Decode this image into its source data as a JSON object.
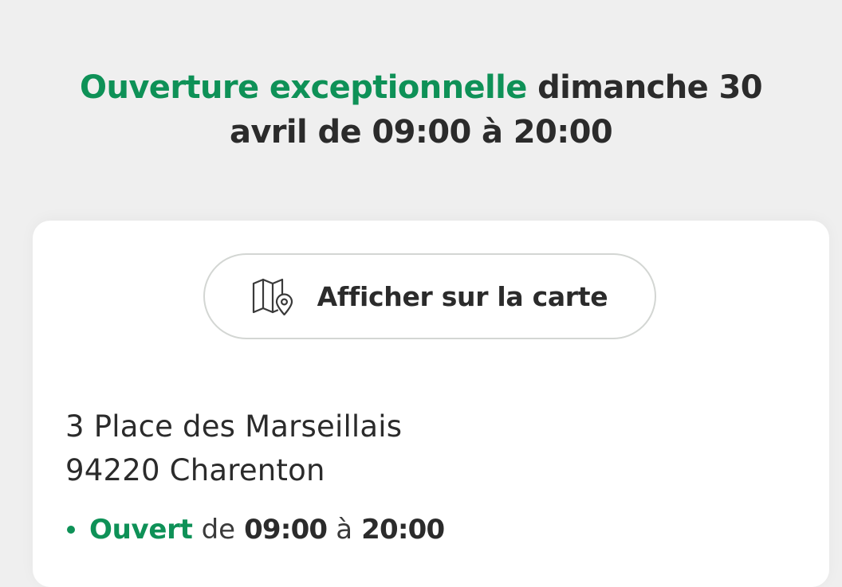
{
  "banner": {
    "highlight": "Ouverture exceptionnelle",
    "rest_line1": "dimanche 30",
    "rest_line2": "avril de 09:00 à 20:00"
  },
  "map_button": {
    "label": "Afficher sur la carte",
    "icon": "map-pin-icon"
  },
  "address": {
    "line1": "3 Place des Marseillais",
    "line2": "94220 Charenton"
  },
  "status": {
    "state": "Ouvert",
    "from_word": "de",
    "open_time": "09:00",
    "to_word": "à",
    "close_time": "20:00"
  },
  "colors": {
    "accent": "#0e9157",
    "text": "#2b2b2b",
    "background": "#efefef",
    "card": "#ffffff"
  }
}
